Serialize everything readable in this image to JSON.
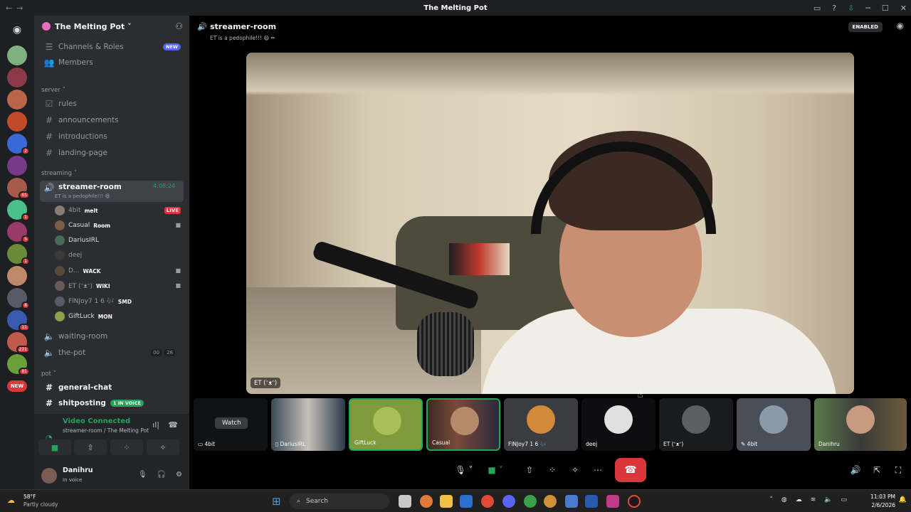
{
  "window": {
    "title": "The Melting Pot",
    "nav_back": "←",
    "nav_fwd": "→"
  },
  "server": {
    "name": "The Melting Pot"
  },
  "servers": [
    {
      "color": "#7fb07f",
      "badge": ""
    },
    {
      "color": "#8c3a4a",
      "badge": ""
    },
    {
      "color": "#b8654a",
      "badge": ""
    },
    {
      "color": "#c04a2a",
      "badge": ""
    },
    {
      "color": "#3a6ad8",
      "badge": "2"
    },
    {
      "color": "#7a3a8a",
      "badge": ""
    },
    {
      "color": "#a55a4a",
      "badge": "65"
    },
    {
      "color": "#4ac08a",
      "badge": "1"
    },
    {
      "color": "#9a3a6a",
      "badge": "5"
    },
    {
      "color": "#6a8a3a",
      "badge": "1"
    },
    {
      "color": "#c08a6a",
      "badge": ""
    },
    {
      "color": "#5a5a6a",
      "badge": "8"
    },
    {
      "color": "#3a5ab0",
      "badge": "11"
    },
    {
      "color": "#c05a4a",
      "badge": "221"
    },
    {
      "color": "#6aa03a",
      "badge": "81"
    },
    {
      "color": "#da373c",
      "badge": "NEW"
    }
  ],
  "sidebar": {
    "top_items": [
      {
        "label": "Channels & Roles",
        "badge": "NEW"
      },
      {
        "label": "Members"
      }
    ],
    "cat_server": "server",
    "server_channels": [
      "rules",
      "announcements",
      "introductions",
      "landing-page"
    ],
    "cat_streaming": "streaming",
    "active_channel": {
      "name": "streamer-room",
      "topic": "ET is a pedophile!!! 😄",
      "timer": "4:08:24"
    },
    "voice_users": [
      {
        "name": "4bit",
        "activity": "melt",
        "live": "LIVE"
      },
      {
        "name": "Casual",
        "activity": "Room"
      },
      {
        "name": "DariusIRL",
        "activity": ""
      },
      {
        "name": "deej",
        "activity": ""
      },
      {
        "name": "D...",
        "activity": "WACK"
      },
      {
        "name": "ET (ᵔᴥᵔ)",
        "activity": "WIKI"
      },
      {
        "name": "FlNJoy7 1 6 🎶",
        "activity": "SMD"
      },
      {
        "name": "GiftLuck",
        "activity": "MON"
      }
    ],
    "waiting_room": "waiting-room",
    "the_pot": "the-pot",
    "the_pot_counts": [
      "00",
      "28"
    ],
    "cat_pot": "pot",
    "general_chat": "general-chat",
    "shitposting": "shitposting",
    "in_voice_badge": "1 IN VOICE"
  },
  "voice_panel": {
    "status": "Video Connected",
    "sub": "streamer-room / The Melting Pot"
  },
  "user": {
    "name": "Danihru",
    "status": "In voice"
  },
  "channel_header": {
    "name": "streamer-room",
    "topic": "ET is a pedophile!!! 😄 ✏",
    "enabled": "ENABLED"
  },
  "main_video": {
    "label": "ET (ᵔᴥᵔ)"
  },
  "tiles": [
    {
      "label": "4bit",
      "watch": "Watch"
    },
    {
      "label": "DariusIRL"
    },
    {
      "label": "GiftLuck"
    },
    {
      "label": "Casual"
    },
    {
      "label": "FlNJoy7 1 6 🎶"
    },
    {
      "label": "deej"
    },
    {
      "label": "ET (ᵔᴥᵔ)"
    },
    {
      "label": "4bit"
    },
    {
      "label": "Danihru"
    }
  ],
  "taskbar": {
    "temp": "58°F",
    "weather": "Partly cloudy",
    "search": "Search",
    "time": "11:03 PM",
    "date": "2/6/2026"
  }
}
